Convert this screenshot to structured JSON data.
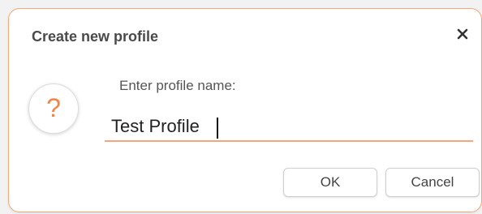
{
  "dialog": {
    "title": "Create new profile",
    "prompt": "Enter profile name:",
    "input_value": "Test Profile",
    "ok_label": "OK",
    "cancel_label": "Cancel",
    "question_glyph": "?",
    "icons": {
      "close": "close-icon",
      "question": "question-icon"
    },
    "colors": {
      "accent": "#f4a77c",
      "question": "#f08545"
    }
  }
}
